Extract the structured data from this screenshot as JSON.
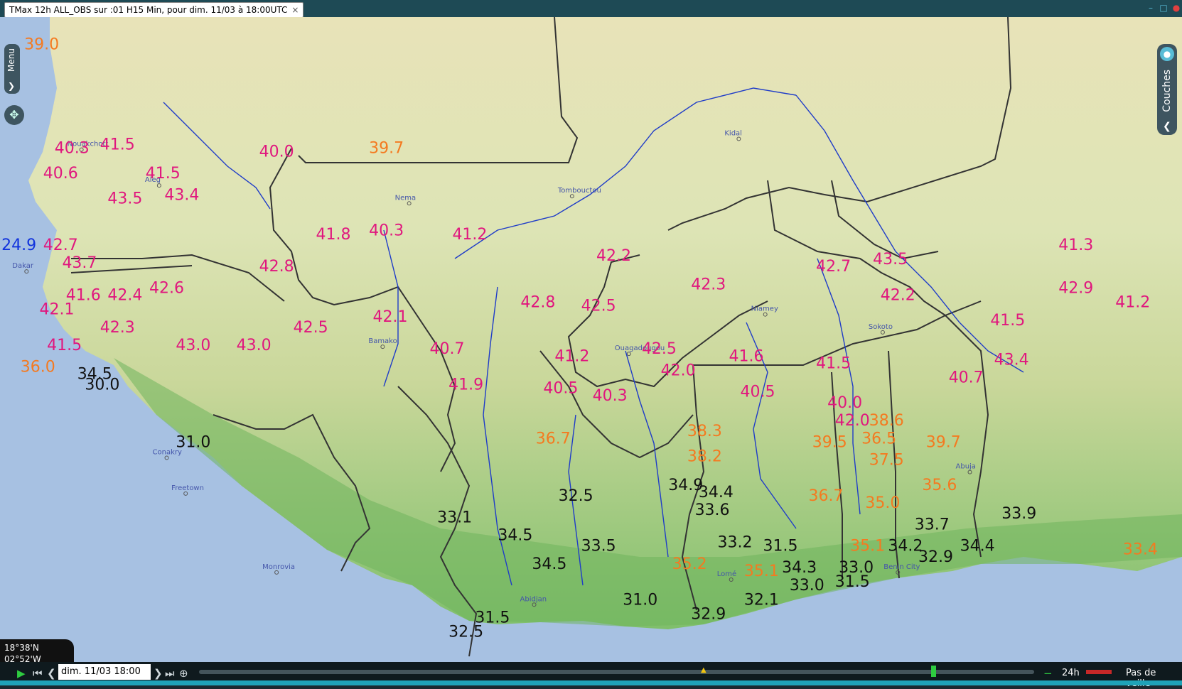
{
  "window": {
    "tab_title": "TMax 12h ALL_OBS sur :01 H15 Min,  pour dim. 11/03 à 18:00UTC",
    "tab_close": "×",
    "min": "–",
    "max": "□",
    "close": "●"
  },
  "colors": {
    "ocean": "#a7c1e2",
    "land_low": "#7fbf6b",
    "land_mid": "#c9d79a",
    "sahel": "#dde4b5",
    "desert": "#e8e3b8",
    "border": "#333333",
    "river": "#1f3cc8",
    "hot": "#e0177e",
    "warm": "#f47a20",
    "cool": "#111111",
    "cold": "#1133dd"
  },
  "ui": {
    "menu": "Menu",
    "menu_chevron": "❯",
    "pan": "✥",
    "layers": "Couches",
    "layers_chevron": "❮",
    "layers_icon": "●"
  },
  "coordinate_readout": "18°38'N 02°52'W",
  "timebar": {
    "date": "dim. 11/03 18:00",
    "step": "24h",
    "veille": "Pas de veille",
    "play": "▶",
    "first": "⏮",
    "prev": "❮",
    "next": "❯",
    "last": "⏭",
    "zoom": "⊕",
    "minus": "−",
    "marker": "▲"
  },
  "observations": [
    {
      "v": "39.0",
      "c": "warm",
      "x": -17.0,
      "y": 20.9
    },
    {
      "v": "40.3",
      "c": "hot",
      "x": -16.2,
      "y": 18.0
    },
    {
      "v": "41.5",
      "c": "hot",
      "x": -15.0,
      "y": 18.1
    },
    {
      "v": "40.6",
      "c": "hot",
      "x": -16.5,
      "y": 17.3
    },
    {
      "v": "41.5",
      "c": "hot",
      "x": -13.8,
      "y": 17.3
    },
    {
      "v": "43.4",
      "c": "hot",
      "x": -13.3,
      "y": 16.7
    },
    {
      "v": "43.5",
      "c": "hot",
      "x": -14.8,
      "y": 16.6
    },
    {
      "v": "24.9",
      "c": "cold",
      "x": -17.6,
      "y": 15.3
    },
    {
      "v": "42.7",
      "c": "hot",
      "x": -16.5,
      "y": 15.3
    },
    {
      "v": "43.7",
      "c": "hot",
      "x": -16.0,
      "y": 14.8
    },
    {
      "v": "41.6",
      "c": "hot",
      "x": -15.9,
      "y": 13.9
    },
    {
      "v": "42.4",
      "c": "hot",
      "x": -14.8,
      "y": 13.9
    },
    {
      "v": "42.1",
      "c": "hot",
      "x": -16.6,
      "y": 13.5
    },
    {
      "v": "42.6",
      "c": "hot",
      "x": -13.7,
      "y": 14.1
    },
    {
      "v": "42.3",
      "c": "hot",
      "x": -15.0,
      "y": 13.0
    },
    {
      "v": "41.5",
      "c": "hot",
      "x": -16.4,
      "y": 12.5
    },
    {
      "v": "43.0",
      "c": "hot",
      "x": -13.0,
      "y": 12.5
    },
    {
      "v": "43.0",
      "c": "hot",
      "x": -11.4,
      "y": 12.5
    },
    {
      "v": "36.0",
      "c": "warm",
      "x": -17.1,
      "y": 11.9
    },
    {
      "v": "34.5",
      "c": "cool",
      "x": -15.6,
      "y": 11.7
    },
    {
      "v": "30.0",
      "c": "cool",
      "x": -15.4,
      "y": 11.4
    },
    {
      "v": "40.0",
      "c": "hot",
      "x": -10.8,
      "y": 17.9
    },
    {
      "v": "39.7",
      "c": "warm",
      "x": -7.9,
      "y": 18.0
    },
    {
      "v": "41.8",
      "c": "hot",
      "x": -9.3,
      "y": 15.6
    },
    {
      "v": "40.3",
      "c": "hot",
      "x": -7.9,
      "y": 15.7
    },
    {
      "v": "41.2",
      "c": "hot",
      "x": -5.7,
      "y": 15.6
    },
    {
      "v": "42.8",
      "c": "hot",
      "x": -10.8,
      "y": 14.7
    },
    {
      "v": "42.5",
      "c": "hot",
      "x": -9.9,
      "y": 13.0
    },
    {
      "v": "42.1",
      "c": "hot",
      "x": -7.8,
      "y": 13.3
    },
    {
      "v": "40.7",
      "c": "hot",
      "x": -6.3,
      "y": 12.4
    },
    {
      "v": "42.8",
      "c": "hot",
      "x": -3.9,
      "y": 13.7
    },
    {
      "v": "42.5",
      "c": "hot",
      "x": -2.3,
      "y": 13.6
    },
    {
      "v": "42.2",
      "c": "hot",
      "x": -1.9,
      "y": 15.0
    },
    {
      "v": "41.2",
      "c": "hot",
      "x": -3.0,
      "y": 12.2
    },
    {
      "v": "41.9",
      "c": "hot",
      "x": -5.8,
      "y": 11.4
    },
    {
      "v": "40.5",
      "c": "hot",
      "x": -3.3,
      "y": 11.3
    },
    {
      "v": "40.3",
      "c": "hot",
      "x": -2.0,
      "y": 11.1
    },
    {
      "v": "36.7",
      "c": "warm",
      "x": -3.5,
      "y": 9.9
    },
    {
      "v": "42.5",
      "c": "hot",
      "x": -0.7,
      "y": 12.4
    },
    {
      "v": "42.0",
      "c": "hot",
      "x": -0.2,
      "y": 11.8
    },
    {
      "v": "42.3",
      "c": "hot",
      "x": 0.6,
      "y": 14.2
    },
    {
      "v": "41.6",
      "c": "hot",
      "x": 1.6,
      "y": 12.2
    },
    {
      "v": "40.5",
      "c": "hot",
      "x": 1.9,
      "y": 11.2
    },
    {
      "v": "42.7",
      "c": "hot",
      "x": 3.9,
      "y": 14.7
    },
    {
      "v": "43.5",
      "c": "hot",
      "x": 5.4,
      "y": 14.9
    },
    {
      "v": "42.2",
      "c": "hot",
      "x": 5.6,
      "y": 13.9
    },
    {
      "v": "41.5",
      "c": "hot",
      "x": 3.9,
      "y": 12.0
    },
    {
      "v": "40.0",
      "c": "hot",
      "x": 4.2,
      "y": 10.9
    },
    {
      "v": "42.0",
      "c": "hot",
      "x": 4.4,
      "y": 10.4
    },
    {
      "v": "38.6",
      "c": "warm",
      "x": 5.3,
      "y": 10.4
    },
    {
      "v": "36.5",
      "c": "warm",
      "x": 5.1,
      "y": 9.9
    },
    {
      "v": "37.5",
      "c": "warm",
      "x": 5.3,
      "y": 9.3
    },
    {
      "v": "38.3",
      "c": "warm",
      "x": 0.5,
      "y": 10.1
    },
    {
      "v": "38.2",
      "c": "warm",
      "x": 0.5,
      "y": 9.4
    },
    {
      "v": "39.5",
      "c": "warm",
      "x": 3.8,
      "y": 9.8
    },
    {
      "v": "39.7",
      "c": "warm",
      "x": 6.8,
      "y": 9.8
    },
    {
      "v": "35.6",
      "c": "warm",
      "x": 6.7,
      "y": 8.6
    },
    {
      "v": "36.7",
      "c": "warm",
      "x": 3.7,
      "y": 8.3
    },
    {
      "v": "35.0",
      "c": "warm",
      "x": 5.2,
      "y": 8.1
    },
    {
      "v": "41.3",
      "c": "hot",
      "x": 10.3,
      "y": 15.3
    },
    {
      "v": "42.9",
      "c": "hot",
      "x": 10.3,
      "y": 14.1
    },
    {
      "v": "41.2",
      "c": "hot",
      "x": 11.8,
      "y": 13.7
    },
    {
      "v": "41.5",
      "c": "hot",
      "x": 8.5,
      "y": 13.2
    },
    {
      "v": "43.4",
      "c": "hot",
      "x": 8.6,
      "y": 12.1
    },
    {
      "v": "40.7",
      "c": "hot",
      "x": 7.4,
      "y": 11.6
    },
    {
      "v": "33.1",
      "c": "cool",
      "x": -6.1,
      "y": 7.7
    },
    {
      "v": "32.5",
      "c": "cool",
      "x": -2.9,
      "y": 8.3
    },
    {
      "v": "34.9",
      "c": "cool",
      "x": 0.0,
      "y": 8.6
    },
    {
      "v": "34.4",
      "c": "cool",
      "x": 0.8,
      "y": 8.4
    },
    {
      "v": "33.6",
      "c": "cool",
      "x": 0.7,
      "y": 7.9
    },
    {
      "v": "34.5",
      "c": "cool",
      "x": -4.5,
      "y": 7.2
    },
    {
      "v": "33.5",
      "c": "cool",
      "x": -2.3,
      "y": 6.9
    },
    {
      "v": "33.2",
      "c": "cool",
      "x": 1.3,
      "y": 7.0
    },
    {
      "v": "31.5",
      "c": "cool",
      "x": 2.5,
      "y": 6.9
    },
    {
      "v": "35.1",
      "c": "warm",
      "x": 4.8,
      "y": 6.9
    },
    {
      "v": "34.2",
      "c": "cool",
      "x": 5.8,
      "y": 6.9
    },
    {
      "v": "32.9",
      "c": "cool",
      "x": 6.6,
      "y": 6.6
    },
    {
      "v": "34.4",
      "c": "cool",
      "x": 7.7,
      "y": 6.9
    },
    {
      "v": "33.7",
      "c": "cool",
      "x": 6.5,
      "y": 7.5
    },
    {
      "v": "33.9",
      "c": "cool",
      "x": 8.8,
      "y": 7.8
    },
    {
      "v": "34.5",
      "c": "cool",
      "x": -3.6,
      "y": 6.4
    },
    {
      "v": "35.2",
      "c": "warm",
      "x": 0.1,
      "y": 6.4
    },
    {
      "v": "34.3",
      "c": "cool",
      "x": 3.0,
      "y": 6.3
    },
    {
      "v": "35.1",
      "c": "warm",
      "x": 2.0,
      "y": 6.2
    },
    {
      "v": "33.0",
      "c": "cool",
      "x": 4.5,
      "y": 6.3
    },
    {
      "v": "33.0",
      "c": "cool",
      "x": 3.2,
      "y": 5.8
    },
    {
      "v": "31.5",
      "c": "cool",
      "x": 4.4,
      "y": 5.9
    },
    {
      "v": "31.0",
      "c": "cool",
      "x": -1.2,
      "y": 5.4
    },
    {
      "v": "32.1",
      "c": "cool",
      "x": 2.0,
      "y": 5.4
    },
    {
      "v": "32.9",
      "c": "cool",
      "x": 0.6,
      "y": 5.0
    },
    {
      "v": "31.5",
      "c": "cool",
      "x": -5.1,
      "y": 4.9
    },
    {
      "v": "32.5",
      "c": "cool",
      "x": -5.8,
      "y": 4.5
    },
    {
      "v": "31.0",
      "c": "cool",
      "x": -13.0,
      "y": 9.8
    },
    {
      "v": "33.4",
      "c": "warm",
      "x": 12.0,
      "y": 6.8
    }
  ],
  "places": [
    {
      "n": "Nouakchott",
      "x": -15.95,
      "y": 18.1
    },
    {
      "n": "Aleg",
      "x": -13.9,
      "y": 17.1
    },
    {
      "n": "Nema",
      "x": -7.3,
      "y": 16.6
    },
    {
      "n": "Tombouctou",
      "x": -3.0,
      "y": 16.8
    },
    {
      "n": "Bamako",
      "x": -8.0,
      "y": 12.6
    },
    {
      "n": "Ouagadougou",
      "x": -1.5,
      "y": 12.4
    },
    {
      "n": "Niamey",
      "x": 2.1,
      "y": 13.5
    },
    {
      "n": "Abuja",
      "x": 7.5,
      "y": 9.1
    },
    {
      "n": "Lomé",
      "x": 1.2,
      "y": 6.1
    },
    {
      "n": "Abidjan",
      "x": -4.0,
      "y": 5.4
    },
    {
      "n": "Conakry",
      "x": -13.7,
      "y": 9.5
    },
    {
      "n": "Freetown",
      "x": -13.2,
      "y": 8.5
    },
    {
      "n": "Monrovia",
      "x": -10.8,
      "y": 6.3
    },
    {
      "n": "Dakar",
      "x": -17.4,
      "y": 14.7
    },
    {
      "n": "Kidal",
      "x": 1.4,
      "y": 18.4
    },
    {
      "n": "Sokoto",
      "x": 5.2,
      "y": 13.0
    },
    {
      "n": "Benin City",
      "x": 5.6,
      "y": 6.3
    }
  ]
}
